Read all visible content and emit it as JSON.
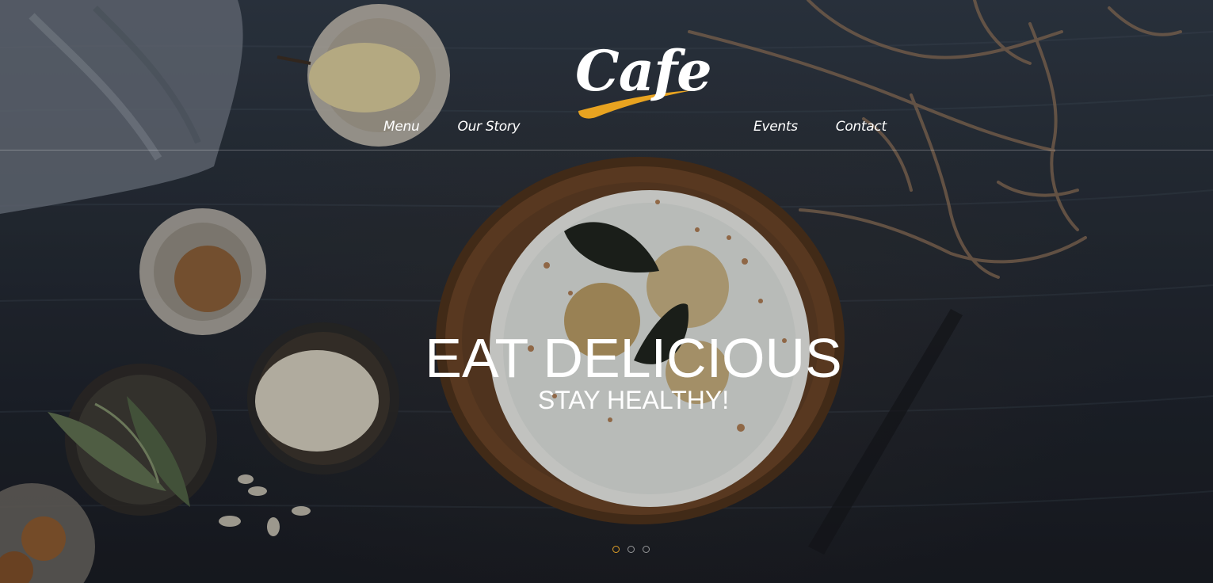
{
  "logo": {
    "text": "Cafe",
    "accent_color": "#e8a320"
  },
  "nav": {
    "left": [
      {
        "label": "Menu"
      },
      {
        "label": "Our Story"
      }
    ],
    "right": [
      {
        "label": "Events"
      },
      {
        "label": "Contact"
      }
    ]
  },
  "hero": {
    "title": "EAT DELICIOUS",
    "subtitle": "STAY HEALTHY!"
  },
  "slider": {
    "slide_count": 3,
    "active_index": 0,
    "active_color": "#e0a027"
  },
  "colors": {
    "background": "#262d36",
    "text": "#ffffff"
  }
}
